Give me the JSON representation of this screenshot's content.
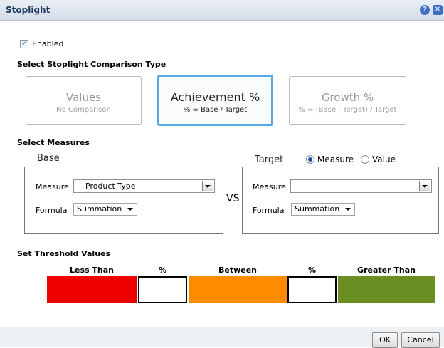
{
  "dialog": {
    "title": "Stoplight"
  },
  "enabled": {
    "label": "Enabled",
    "checked": true
  },
  "comparison": {
    "heading": "Select Stoplight Comparison Type",
    "options": [
      {
        "title": "Values",
        "subtitle": "No Comparison",
        "selected": false
      },
      {
        "title": "Achievement %",
        "subtitle": "% = Base / Target",
        "selected": true
      },
      {
        "title": "Growth %",
        "subtitle": "% = (Base - Target) / Target",
        "selected": false
      }
    ]
  },
  "measures": {
    "heading": "Select Measures",
    "base": {
      "label": "Base",
      "measure_label": "Measure",
      "measure_value": "Product Type",
      "formula_label": "Formula",
      "formula_value": "Summation"
    },
    "vs": "VS",
    "target": {
      "label": "Target",
      "radio_measure": "Measure",
      "radio_value": "Value",
      "selected_radio": "Measure",
      "measure_label": "Measure",
      "measure_value": "",
      "formula_label": "Formula",
      "formula_value": "Summation"
    }
  },
  "threshold": {
    "heading": "Set Threshold Values",
    "columns": [
      "Less Than",
      "%",
      "Between",
      "%",
      "Greater Than"
    ],
    "colors": {
      "less_than": "#ee0000",
      "between": "#ff8c00",
      "greater_than": "#6b8e23"
    },
    "values": [
      "",
      ""
    ]
  },
  "footer": {
    "ok": "OK",
    "cancel": "Cancel"
  }
}
